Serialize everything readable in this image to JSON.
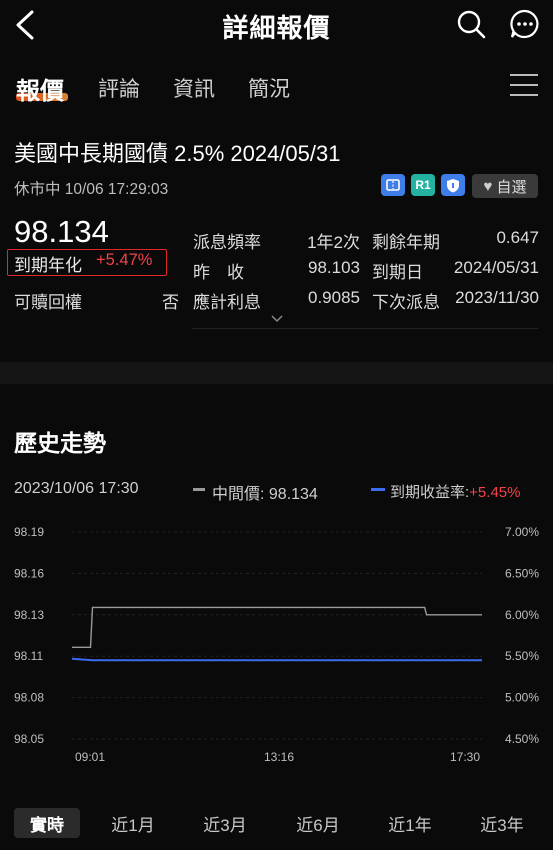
{
  "header": {
    "title": "詳細報價",
    "icons": [
      "back-icon",
      "search-icon",
      "chat-more-icon"
    ]
  },
  "tabs": [
    {
      "label": "報價",
      "active": true
    },
    {
      "label": "評論"
    },
    {
      "label": "資訊"
    },
    {
      "label": "簡況"
    }
  ],
  "bond": {
    "name": "美國中長期國債 2.5% 2024/05/31",
    "status": "休市中 10/06 17:29:03",
    "badges": [
      "ticket-icon",
      "R1",
      "shield-icon"
    ],
    "watch_label": "自選",
    "price": "98.134",
    "ytm_label": "到期年化",
    "ytm_value": "+5.47%",
    "callable_label": "可贖回權",
    "callable_value": "否",
    "fields": [
      {
        "label": "派息頻率",
        "value": "1年2次"
      },
      {
        "label": "昨　收",
        "value": "98.103"
      },
      {
        "label": "應計利息",
        "value": "0.9085"
      },
      {
        "label": "剩餘年期",
        "value": "0.647"
      },
      {
        "label": "到期日",
        "value": "2024/05/31"
      },
      {
        "label": "下次派息",
        "value": "2023/11/30"
      }
    ]
  },
  "history": {
    "title": "歷史走勢",
    "timestamp": "2023/10/06 17:30",
    "legend_mid_label": "中間價: 98.134",
    "legend_ytm_label": "到期收益率:",
    "legend_ytm_value": "+5.45%"
  },
  "chart_data": {
    "type": "line",
    "x_ticks": [
      "09:01",
      "13:16",
      "17:30"
    ],
    "y_left_ticks": [
      "98.19",
      "98.16",
      "98.13",
      "98.11",
      "98.08",
      "98.05"
    ],
    "y_right_ticks": [
      "7.00%",
      "6.50%",
      "6.00%",
      "5.50%",
      "5.00%",
      "4.50%"
    ],
    "ylim_left": [
      98.05,
      98.19
    ],
    "ylim_right": [
      4.5,
      7.0
    ],
    "colors": {
      "mid": "#9a9a9a",
      "ytm": "#3c6df0"
    },
    "series": [
      {
        "name": "中間價",
        "axis": "left",
        "points": [
          [
            0,
            98.112
          ],
          [
            0.045,
            98.112
          ],
          [
            0.05,
            98.139
          ],
          [
            0.86,
            98.139
          ],
          [
            0.865,
            98.134
          ],
          [
            1,
            98.134
          ]
        ]
      },
      {
        "name": "到期收益率",
        "axis": "right",
        "points": [
          [
            0,
            5.47
          ],
          [
            0.05,
            5.45
          ],
          [
            0.9,
            5.45
          ],
          [
            1,
            5.45
          ]
        ]
      }
    ]
  },
  "periods": [
    {
      "label": "實時",
      "active": true
    },
    {
      "label": "近1月"
    },
    {
      "label": "近3月"
    },
    {
      "label": "近6月"
    },
    {
      "label": "近1年"
    },
    {
      "label": "近3年"
    }
  ]
}
